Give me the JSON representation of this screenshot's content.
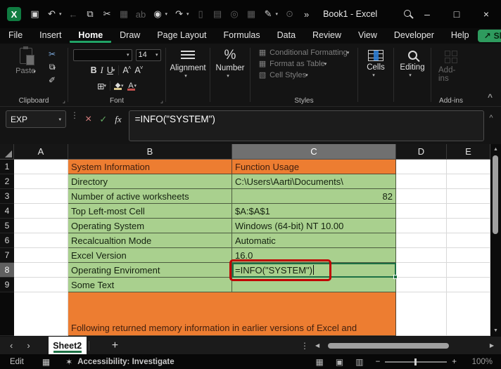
{
  "titlebar": {
    "title": "Book1  -  Excel"
  },
  "icons": {
    "logo": "X",
    "save": "▣",
    "undo": "↶",
    "back": "←",
    "copy": "⧉",
    "cut": "✂",
    "picture": "▦",
    "replace": "ab",
    "touch_mode": "◉",
    "redo": "↷",
    "new_file": "▯",
    "print": "▤",
    "camera": "◎",
    "sheet_search": "▦",
    "doc_edit": "✎",
    "lock_search": "⊙",
    "more": "»",
    "minimize": "–",
    "maximize": "□",
    "close": "×",
    "chevron_down": "▾",
    "chevron_up": "^",
    "dialog_launcher": "⌟",
    "share_arrow": "↗",
    "bold": "B",
    "italic": "I",
    "underline": "U",
    "font_grow": "A",
    "font_shrink": "A",
    "borders": "⊞",
    "fill_color": "◆",
    "font_color": "A",
    "percent": "%",
    "cf_icon": "▦",
    "fat_icon": "▦",
    "cs_icon": "▧",
    "cancel": "×",
    "enter": "✓",
    "fx": "fx",
    "dots_v": "⋮",
    "prev": "‹",
    "next": "›",
    "add_sheet": "+",
    "left": "◀",
    "right": "▶",
    "up": "▲",
    "down": "▼",
    "macro": "▦",
    "accessibility": "✶",
    "view_normal": "▦",
    "view_layout": "▣",
    "view_break": "▥",
    "minus": "−",
    "plus": "+"
  },
  "menubar": {
    "tabs": [
      "File",
      "Insert",
      "Home",
      "Draw",
      "Page Layout",
      "Formulas",
      "Data",
      "Review",
      "View",
      "Developer",
      "Help"
    ],
    "active_tab": "Home",
    "share_label": "Share"
  },
  "ribbon": {
    "clipboard": {
      "group_label": "Clipboard",
      "paste_label": "Paste"
    },
    "font": {
      "group_label": "Font",
      "font_name": "",
      "font_size": "14"
    },
    "alignment": {
      "group_label": "Alignment",
      "button_label": "Alignment"
    },
    "number": {
      "group_label": "Number",
      "button_label": "Number"
    },
    "styles": {
      "group_label": "Styles",
      "items": [
        "Conditional Formatting",
        "Format as Table",
        "Cell Styles"
      ]
    },
    "cells": {
      "group_label": "Cells",
      "button_label": "Cells"
    },
    "editing": {
      "group_label": "Editing",
      "button_label": "Editing"
    },
    "addins": {
      "group_label": "Add-ins",
      "button_label": "Add-ins"
    }
  },
  "formula_bar": {
    "name_box": "EXP",
    "formula": "=INFO(\"SYSTEM\")"
  },
  "grid": {
    "column_headers": [
      "A",
      "B",
      "C",
      "D",
      "E"
    ],
    "selected_column": "C",
    "active_row": 8,
    "rows": [
      {
        "n": 1,
        "b": "System Information",
        "c": "Function Usage",
        "fill": "orange"
      },
      {
        "n": 2,
        "b": "Directory",
        "c": "C:\\Users\\Aarti\\Documents\\",
        "fill": "green"
      },
      {
        "n": 3,
        "b": "Number of active worksheets",
        "c": "82",
        "fill": "green",
        "c_align": "right"
      },
      {
        "n": 4,
        "b": "Top Left-most Cell",
        "c": "$A:$A$1",
        "fill": "green"
      },
      {
        "n": 5,
        "b": "Operating System",
        "c": "Windows (64-bit) NT 10.00",
        "fill": "green"
      },
      {
        "n": 6,
        "b": "Recalcualtion Mode",
        "c": "Automatic",
        "fill": "green"
      },
      {
        "n": 7,
        "b": "Excel Version",
        "c": "16.0",
        "fill": "green"
      },
      {
        "n": 8,
        "b": "Operating Enviroment",
        "c": "=INFO(\"SYSTEM\")",
        "fill": "green",
        "caret": true
      },
      {
        "n": 9,
        "b": "Some Text",
        "c": "",
        "fill": "green"
      }
    ],
    "banner_text": "Following returned memory information in earlier versions of Excel and"
  },
  "sheet_tabs": {
    "tabs": [
      {
        "label": "Sheet2",
        "active": true
      }
    ]
  },
  "status_bar": {
    "mode": "Edit",
    "accessibility": "Accessibility: Investigate",
    "zoom_level": "100%"
  },
  "colors": {
    "orange_fill": "#ED7D31",
    "green_fill": "#A9D08E",
    "excel_green": "#21A366",
    "annotation_red": "#C00000",
    "share_green": "#2E9B5E",
    "selection_green": "#1D6F44"
  }
}
